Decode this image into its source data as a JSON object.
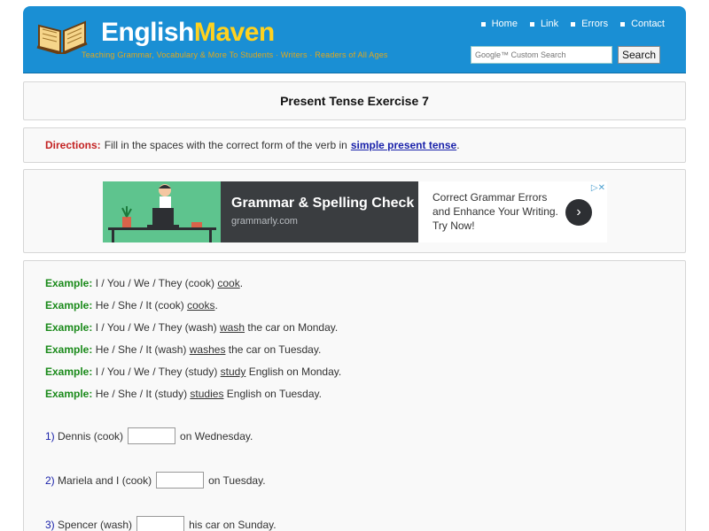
{
  "header": {
    "logo_part1": "English",
    "logo_part2": "Maven",
    "tagline": "Teaching Grammar, Vocabulary & More To Students · Writers · Readers of All Ages",
    "nav": [
      {
        "label": "Home"
      },
      {
        "label": "Link"
      },
      {
        "label": "Errors"
      },
      {
        "label": "Contact"
      }
    ],
    "search_placeholder": "Google™ Custom Search",
    "search_button": "Search"
  },
  "page": {
    "title": "Present Tense Exercise 7",
    "directions_label": "Directions:",
    "directions_text": "Fill in the spaces with the correct form of the verb in",
    "directions_link": "simple present tense",
    "directions_end": "."
  },
  "ad": {
    "headline": "Grammar & Spelling Check",
    "domain": "grammarly.com",
    "body": "Correct Grammar Errors and Enhance Your Writing. Try Now!",
    "arrow": "›",
    "choices": "▷✕"
  },
  "examples": [
    {
      "label": "Example:",
      "pre": "I / You / We / They (cook)",
      "answer": "cook",
      "post": "."
    },
    {
      "label": "Example:",
      "pre": "He / She / It (cook)",
      "answer": "cooks",
      "post": "."
    },
    {
      "label": "Example:",
      "pre": "I / You / We / They (wash)",
      "answer": "wash",
      "post": "the car on Monday."
    },
    {
      "label": "Example:",
      "pre": "He / She / It (wash)",
      "answer": "washes",
      "post": "the car on Tuesday."
    },
    {
      "label": "Example:",
      "pre": "I / You / We / They (study)",
      "answer": "study",
      "post": "English on Monday."
    },
    {
      "label": "Example:",
      "pre": "He / She / It (study)",
      "answer": "studies",
      "post": "English on Tuesday."
    }
  ],
  "questions": [
    {
      "num": "1)",
      "pre": "Dennis (cook)",
      "post": "on Wednesday."
    },
    {
      "num": "2)",
      "pre": "Mariela and I (cook)",
      "post": "on Tuesday."
    },
    {
      "num": "3)",
      "pre": "Spencer (wash)",
      "post": "his car on Sunday."
    }
  ]
}
